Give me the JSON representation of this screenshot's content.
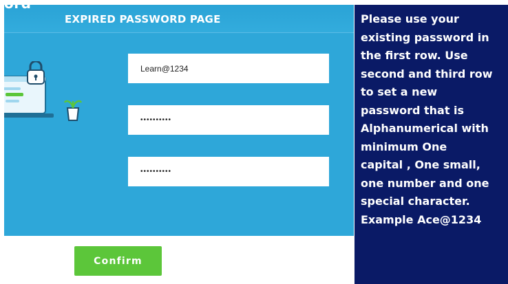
{
  "header": {
    "cut_label": "ord",
    "title": "EXPIRED PASSWORD PAGE"
  },
  "form": {
    "current_password_value": "Learn@1234",
    "new_password_masked": "••••••••••",
    "confirm_password_masked": "••••••••••",
    "confirm_label": "Confirm"
  },
  "info": {
    "text": "Please use your\nexisting password in\nthe first row. Use\nsecond and third row\nto set a new\npassword that is\nAlphanumerical with\nminimum One\ncapital , One small,\none number and one\nspecial character.\nExample Ace@1234"
  },
  "icons": {
    "illustration": "laptop-lock-illustration",
    "lock": "lock-icon",
    "plant": "potted-plant-icon"
  },
  "colors": {
    "panel_blue": "#2ea7d9",
    "info_navy": "#0a1a66",
    "confirm_green": "#5cc63a"
  }
}
